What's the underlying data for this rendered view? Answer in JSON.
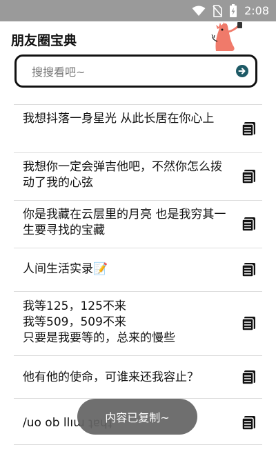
{
  "status_bar": {
    "time": "2:08"
  },
  "app": {
    "title": "朋友圈宝典"
  },
  "search": {
    "placeholder": "搜搜看吧~"
  },
  "items": [
    {
      "text": "我想抖落一身星光 从此长居在你心上"
    },
    {
      "text": "我想你一定会弹吉他吧，不然你怎么拨动了我的心弦"
    },
    {
      "text": "你是我藏在云层里的月亮 也是我穷其一生要寻找的宝藏"
    },
    {
      "text": "人间生活实录📝"
    },
    {
      "text": "我等125，125不来\n我等509，509不来\n只要是我要等的，总来的慢些"
    },
    {
      "text": "他有他的使命，可谁来还我容止？"
    },
    {
      "text": "/uo ob llıɯ ʇɐɥʇ"
    }
  ],
  "toast": {
    "text": "内容已复制~"
  },
  "colors": {
    "status_bar": "#9a9a9a",
    "mascot": "#f07a6a",
    "accent_icon": "#1e5a66"
  }
}
